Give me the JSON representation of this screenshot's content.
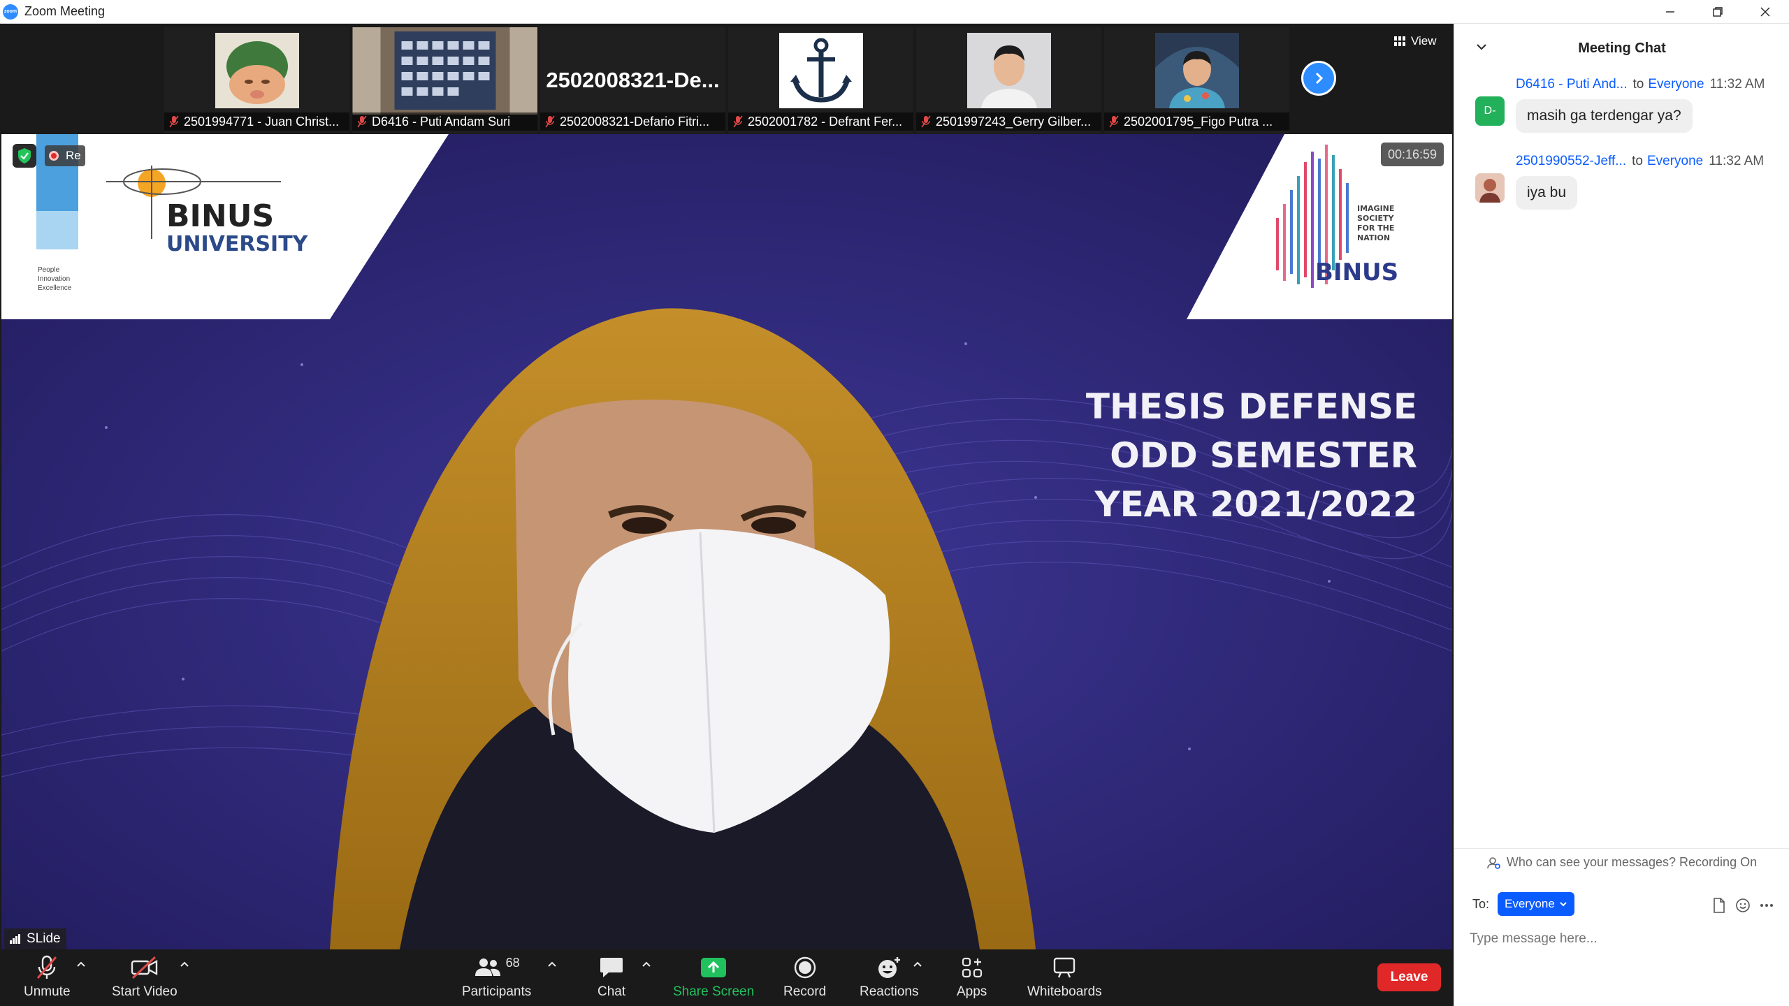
{
  "window": {
    "title": "Zoom Meeting",
    "icon_text": "zoom"
  },
  "thumbnails": [
    {
      "name": "2501994771 - Juan Christ...",
      "kind": "avatar"
    },
    {
      "name": "D6416 - Puti Andam  Suri",
      "kind": "screen"
    },
    {
      "name": "2502008321-Defario Fitri...",
      "kind": "text",
      "big_name": "2502008321-De..."
    },
    {
      "name": "2502001782 - Defrant Fer...",
      "kind": "anchor"
    },
    {
      "name": "2501997243_Gerry Gilber...",
      "kind": "person"
    },
    {
      "name": "2502001795_Figo Putra ...",
      "kind": "person2"
    }
  ],
  "view_button": {
    "label": "View"
  },
  "main_video": {
    "timer": "00:16:59",
    "recording_label": "Re",
    "speaker_name": "SLide",
    "logo_left": {
      "line1": "BINUS",
      "line2": "UNIVERSITY",
      "tagline": [
        "People",
        "Innovation",
        "Excellence"
      ]
    },
    "logo_right": {
      "word": "BINUS",
      "tagline": [
        "IMAGINE",
        "SOCIETY",
        "FOR THE",
        "NATION"
      ]
    },
    "slide_title": [
      "THESIS DEFENSE",
      "ODD SEMESTER",
      "YEAR 2021/2022"
    ]
  },
  "toolbar": {
    "unmute": "Unmute",
    "start_video": "Start Video",
    "participants": "Participants",
    "participant_count": "68",
    "chat": "Chat",
    "share_screen": "Share Screen",
    "record": "Record",
    "reactions": "Reactions",
    "apps": "Apps",
    "whiteboards": "Whiteboards",
    "leave": "Leave"
  },
  "chat": {
    "title": "Meeting Chat",
    "messages": [
      {
        "avatar": "D-",
        "sender": "D6416 - Puti And...",
        "to": "to",
        "recipient": "Everyone",
        "time": "11:32 AM",
        "text": "masih ga terdengar ya?"
      },
      {
        "avatar": "",
        "sender": "2501990552-Jeff...",
        "to": "to",
        "recipient": "Everyone",
        "time": "11:32 AM",
        "text": "iya bu"
      }
    ],
    "who_can_see": "Who can see your messages? Recording On",
    "to_label": "To:",
    "to_value": "Everyone",
    "input_placeholder": "Type message here..."
  },
  "colors": {
    "accent": "#0b5cff",
    "leave": "#e02828",
    "share": "#21c25e",
    "slide_bg": "#2a2470"
  }
}
